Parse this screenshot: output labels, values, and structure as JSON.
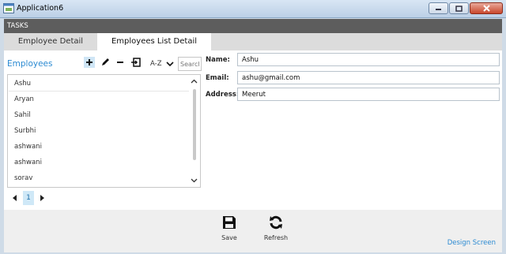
{
  "window": {
    "title": "Application6"
  },
  "tasks_label": "TASKS",
  "tabs": [
    {
      "label": "Employee Detail",
      "active": false
    },
    {
      "label": "Employees List Detail",
      "active": true
    }
  ],
  "list_panel": {
    "title": "Employees",
    "sort_label": "A-Z",
    "search_placeholder": "Search",
    "items": [
      "Ashu",
      "Aryan",
      "Sahil",
      "Surbhi",
      "ashwani",
      "ashwani",
      "sorav"
    ],
    "selected_index": 0,
    "current_page": "1"
  },
  "form": {
    "name_label": "Name:",
    "name_value": "Ashu",
    "email_label": "Email:",
    "email_value": "ashu@gmail.com",
    "address_label": "Address:",
    "address_value": "Meerut"
  },
  "footer": {
    "save_label": "Save",
    "refresh_label": "Refresh",
    "design_screen_label": "Design Screen"
  },
  "colors": {
    "accent": "#2b8ad2",
    "tasks_bar": "#5d5d5d",
    "page_selected": "#cfe8f7"
  },
  "icons": {
    "app": "app-window-icon",
    "add": "plus-icon",
    "edit": "pencil-icon",
    "delete": "minus-icon",
    "export": "export-icon",
    "sort": "chevron-down-icon",
    "save": "floppy-disk-icon",
    "refresh": "refresh-icon"
  }
}
